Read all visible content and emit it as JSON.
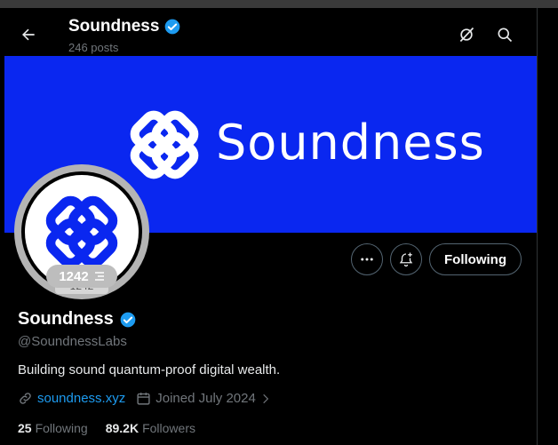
{
  "header": {
    "name": "Soundness",
    "posts": "246 posts"
  },
  "banner": {
    "wordmark": "Soundness",
    "color": "#0a27f0"
  },
  "avatar": {
    "score": "1242",
    "score_ghost": "1242"
  },
  "actions": {
    "more_icon": "more-dots-icon",
    "notify_icon": "bell-plus-icon",
    "follow_label": "Following"
  },
  "profile": {
    "name": "Soundness",
    "handle": "@SoundnessLabs",
    "bio": "Building sound quantum-proof digital wealth.",
    "website": "soundness.xyz",
    "joined": "Joined July 2024",
    "following_count": "25",
    "following_label": "Following",
    "followers_count": "89.2K",
    "followers_label": "Followers"
  },
  "colors": {
    "verified": "#1d9bf0",
    "link": "#1d9bf0",
    "muted": "#71767b"
  }
}
